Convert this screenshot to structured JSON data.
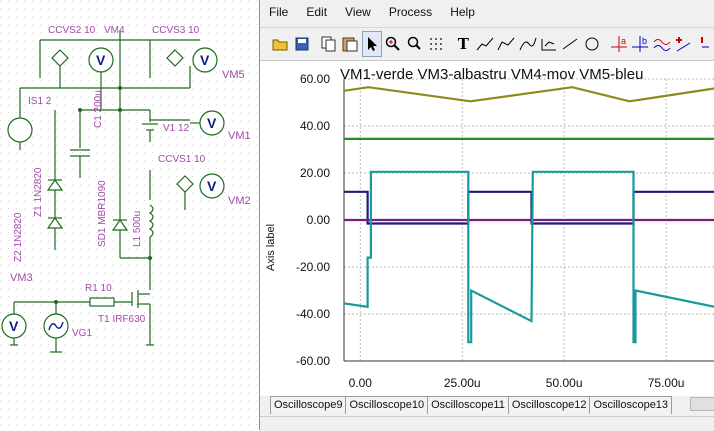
{
  "schematic": {
    "labels": {
      "ccvs2": "CCVS2 10",
      "vm4": "VM4",
      "ccvs3": "CCVS3 10",
      "vm5": "VM5",
      "is1": "IS1 2",
      "c1": "C1 200u",
      "v1": "V1 12",
      "vm1": "VM1",
      "ccvs1": "CCVS1 10",
      "vm2": "VM2",
      "z1": "Z1 1N2820",
      "sd1": "SD1 MBR1090",
      "l1": "L1 500u",
      "z2": "Z2 1N2820",
      "vm3": "VM3",
      "r1": "R1 10",
      "t1": "T1 IRF630",
      "vg1": "VG1"
    },
    "meter_symbol": "V"
  },
  "menu": [
    "File",
    "Edit",
    "View",
    "Process",
    "Help"
  ],
  "toolbar_icons": [
    "open-icon",
    "save-icon",
    "copy-icon",
    "paste-icon",
    "pointer-icon",
    "zoom-icon",
    "zoom-window-icon",
    "grid-icon",
    "text-icon",
    "line-tool-icon",
    "polyline-tool-icon",
    "curve-tool-icon",
    "bracket-tool-icon",
    "segment-icon",
    "circle-icon",
    "cursor-a-icon",
    "cursor-b-icon",
    "wave-icon",
    "add-cursor-icon",
    "more-icon"
  ],
  "toolbar_text": {
    "text_tool": "T",
    "cursor_a": "a",
    "cursor_b": "b"
  },
  "colors": {
    "vm1": "#1f8f1f",
    "vm3": "#1a9a9a",
    "vm4": "#7d1a7d",
    "vm5": "#1b1b7a",
    "olive": "#8b8b1a",
    "grid": "#b9b9b9"
  },
  "tabs": [
    "Oscilloscope9",
    "Oscilloscope10",
    "Oscilloscope11",
    "Oscilloscope12",
    "Oscilloscope13"
  ],
  "chart_data": {
    "type": "line",
    "title": "VM1-verde  VM3-albastru  VM4-mov  VM5-bleu",
    "ylabel": "Axis label",
    "xlabel": "",
    "ylim": [
      -60,
      60
    ],
    "xlim": [
      -4,
      87
    ],
    "yticks": [
      60,
      40,
      20,
      0,
      -20,
      -40,
      -60
    ],
    "ytick_labels": [
      "60.00",
      "40.00",
      "20.00",
      "0.00",
      "-20.00",
      "-40.00",
      "-60.00"
    ],
    "xticks": [
      0,
      25,
      50,
      75
    ],
    "xtick_labels": [
      "0.00",
      "25.00u",
      "50.00u",
      "75.00u"
    ],
    "grid": true,
    "series": [
      {
        "color_key": "olive",
        "x": [
          -4,
          2,
          27,
          52,
          66,
          87
        ],
        "y": [
          55,
          56.5,
          50.5,
          56.5,
          50.5,
          56
        ]
      },
      {
        "color_key": "vm1",
        "x": [
          -4,
          87
        ],
        "y": [
          34.5,
          34.5
        ]
      },
      {
        "color_key": "vm5",
        "x": [
          -4,
          1.8,
          1.8,
          26.5,
          26.5,
          42,
          42,
          67,
          67,
          87
        ],
        "y": [
          12,
          12,
          -1.5,
          -1.5,
          12,
          12,
          -1.5,
          -1.5,
          12,
          12
        ]
      },
      {
        "color_key": "vm4",
        "x": [
          -4,
          87
        ],
        "y": [
          0,
          0
        ]
      },
      {
        "color_key": "vm3",
        "x": [
          -4,
          1.8,
          1.8,
          2.6,
          2.6,
          26.5,
          26.5,
          27.2,
          27.2,
          42,
          42,
          42.3,
          42.3,
          67,
          67,
          67.5,
          67.5,
          87
        ],
        "y": [
          -35.5,
          -37,
          -16,
          -16,
          20.5,
          20.5,
          -52,
          -52,
          -30,
          -43,
          -43,
          20.5,
          20.5,
          20.5,
          -52,
          -52,
          -30,
          -37
        ]
      }
    ]
  }
}
